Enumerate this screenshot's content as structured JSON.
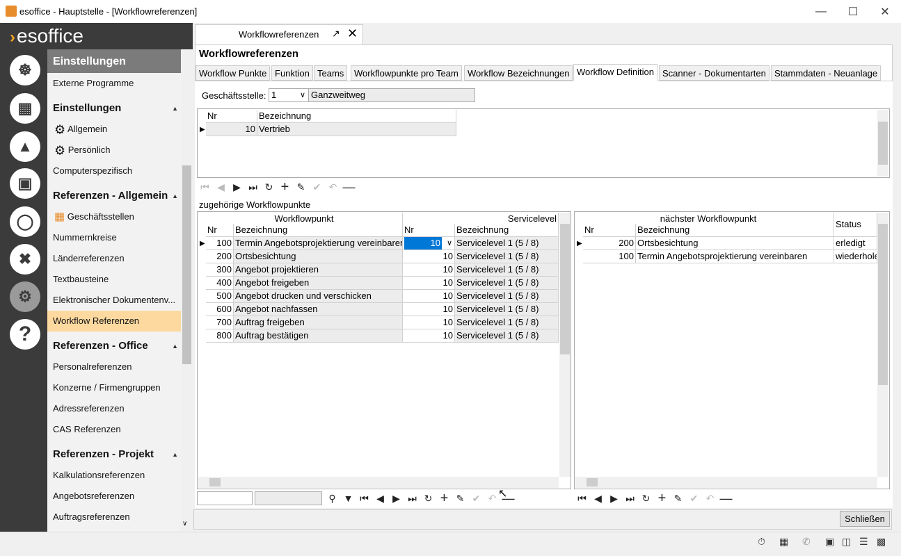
{
  "window": {
    "title": "esoffice - Hauptstelle - [Workflowreferenzen]"
  },
  "logo": {
    "text": "esoffice"
  },
  "nav_icons": [
    "helm-icon",
    "calendar-icon",
    "alarm-light-icon",
    "money-icon",
    "headset-icon",
    "tools-icon",
    "gears-icon",
    "help-icon"
  ],
  "menu": {
    "header": "Einstellungen",
    "top_item": "Externe Programme",
    "sections": [
      {
        "title": "Einstellungen",
        "items": [
          "Allgemein",
          "Persönlich",
          "Computerspezifisch"
        ]
      },
      {
        "title": "Referenzen - Allgemein",
        "items": [
          "Geschäftsstellen",
          "Nummernkreise",
          "Länderreferenzen",
          "Textbausteine",
          "Elektronischer Dokumentenv...",
          "Workflow Referenzen"
        ]
      },
      {
        "title": "Referenzen - Office",
        "items": [
          "Personalreferenzen",
          "Konzerne / Firmengruppen",
          "Adressreferenzen",
          "CAS Referenzen"
        ]
      },
      {
        "title": "Referenzen - Projekt",
        "items": [
          "Kalkulationsreferenzen",
          "Angebotsreferenzen",
          "Auftragsreferenzen"
        ]
      }
    ],
    "active": "Workflow Referenzen"
  },
  "doc_tab": {
    "label": "Workflowreferenzen"
  },
  "page": {
    "title": "Workflowreferenzen"
  },
  "tabs": [
    "Workflow Punkte",
    "Funktion",
    "Teams",
    "Workflowpunkte pro Team",
    "Workflow Bezeichnungen",
    "Workflow Definition",
    "Scanner - Dokumentarten",
    "Stammdaten - Neuanlage"
  ],
  "active_tab": "Workflow Definition",
  "filter": {
    "label": "Geschäftsstelle:",
    "value": "1",
    "name": "Ganzweitweg"
  },
  "top_grid": {
    "headers": [
      "Nr",
      "Bezeichnung"
    ],
    "rows": [
      {
        "nr": "10",
        "bez": "Vertrieb"
      }
    ]
  },
  "section_label": "zugehörige Workflowpunkte",
  "left_grid": {
    "group_headers": [
      "Workflowpunkt",
      "Servicelevel"
    ],
    "headers": [
      "Nr",
      "Bezeichnung",
      "Nr",
      "Bezeichnung"
    ],
    "rows": [
      {
        "nr": "100",
        "bez": "Termin Angebotsprojektierung vereinbaren",
        "snr": "10",
        "sbez": "Servicelevel 1 (5 / 8)"
      },
      {
        "nr": "200",
        "bez": "Ortsbesichtung",
        "snr": "10",
        "sbez": "Servicelevel 1 (5 / 8)"
      },
      {
        "nr": "300",
        "bez": "Angebot projektieren",
        "snr": "10",
        "sbez": "Servicelevel 1 (5 / 8)"
      },
      {
        "nr": "400",
        "bez": "Angebot freigeben",
        "snr": "10",
        "sbez": "Servicelevel 1 (5 / 8)"
      },
      {
        "nr": "500",
        "bez": "Angebot drucken und verschicken",
        "snr": "10",
        "sbez": "Servicelevel 1 (5 / 8)"
      },
      {
        "nr": "600",
        "bez": "Angebot nachfassen",
        "snr": "10",
        "sbez": "Servicelevel 1 (5 / 8)"
      },
      {
        "nr": "700",
        "bez": "Auftrag freigeben",
        "snr": "10",
        "sbez": "Servicelevel 1 (5 / 8)"
      },
      {
        "nr": "800",
        "bez": "Auftrag bestätigen",
        "snr": "10",
        "sbez": "Servicelevel 1 (5 / 8)"
      }
    ]
  },
  "right_grid": {
    "group_header": "nächster Workflowpunkt",
    "headers": [
      "Nr",
      "Bezeichnung",
      "Status"
    ],
    "rows": [
      {
        "nr": "200",
        "bez": "Ortsbesichtung",
        "status": "erledigt"
      },
      {
        "nr": "100",
        "bez": "Termin Angebotsprojektierung vereinbaren",
        "status": "wiederholen"
      }
    ]
  },
  "buttons": {
    "close": "Schließen"
  }
}
